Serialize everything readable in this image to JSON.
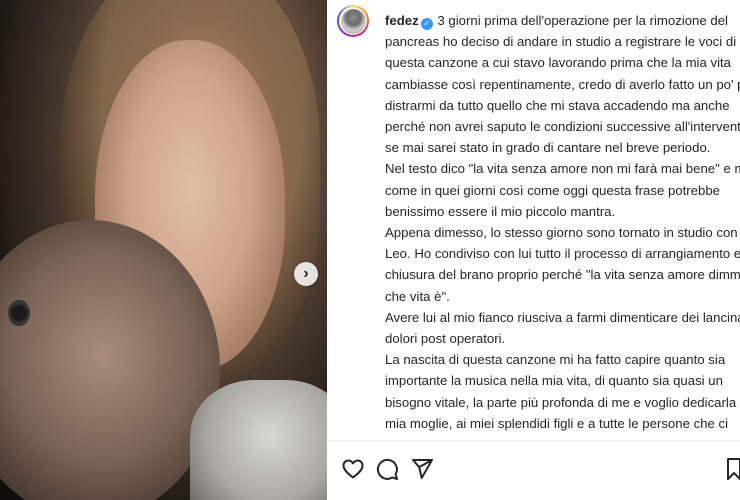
{
  "post": {
    "username": "fedez",
    "verified": true,
    "caption_lines": [
      "3 giorni prima dell'operazione per la rimozione del",
      "pancreas ho deciso di andare in studio a registrare le voci di",
      "questa canzone a cui stavo lavorando prima che la mia vita",
      "cambiasse così repentinamente, credo di averlo fatto un po' per",
      "distrarmi da tutto quello che mi stava accadendo ma anche",
      "perché non avrei saputo le condizioni successive all'intervento e",
      "se mai sarei stato in grado di cantare nel breve periodo.",
      "Nel testo dico \"la vita senza amore non mi farà mai bene\" e mai",
      "come in quei giorni così come oggi questa frase potrebbe",
      "benissimo essere il mio piccolo mantra.",
      "Appena dimesso, lo stesso giorno sono tornato in studio con",
      "Leo. Ho condiviso con lui tutto il processo di arrangiamento e",
      "chiusura del brano proprio perché \"la vita senza amore dimmi tu",
      "che vita è\".",
      "Avere lui al mio fianco riusciva a farmi dimenticare dei lancinanti",
      "dolori post operatori.",
      "La nascita di questa canzone mi ha fatto capire quanto sia",
      "importante la musica nella mia vita, di quanto sia quasi un",
      "bisogno vitale, la parte più profonda di me e voglio dedicarla a",
      "mia moglie, ai miei splendidi figli e a tutte le persone che ci"
    ]
  },
  "icons": {
    "next": "chevron-right-icon",
    "verified": "verified-badge-icon",
    "like": "heart-icon",
    "comment": "comment-icon",
    "share": "send-icon",
    "save": "bookmark-icon"
  },
  "colors": {
    "text": "#262626",
    "verified": "#3897f0",
    "panel_bg": "#ffffff"
  }
}
